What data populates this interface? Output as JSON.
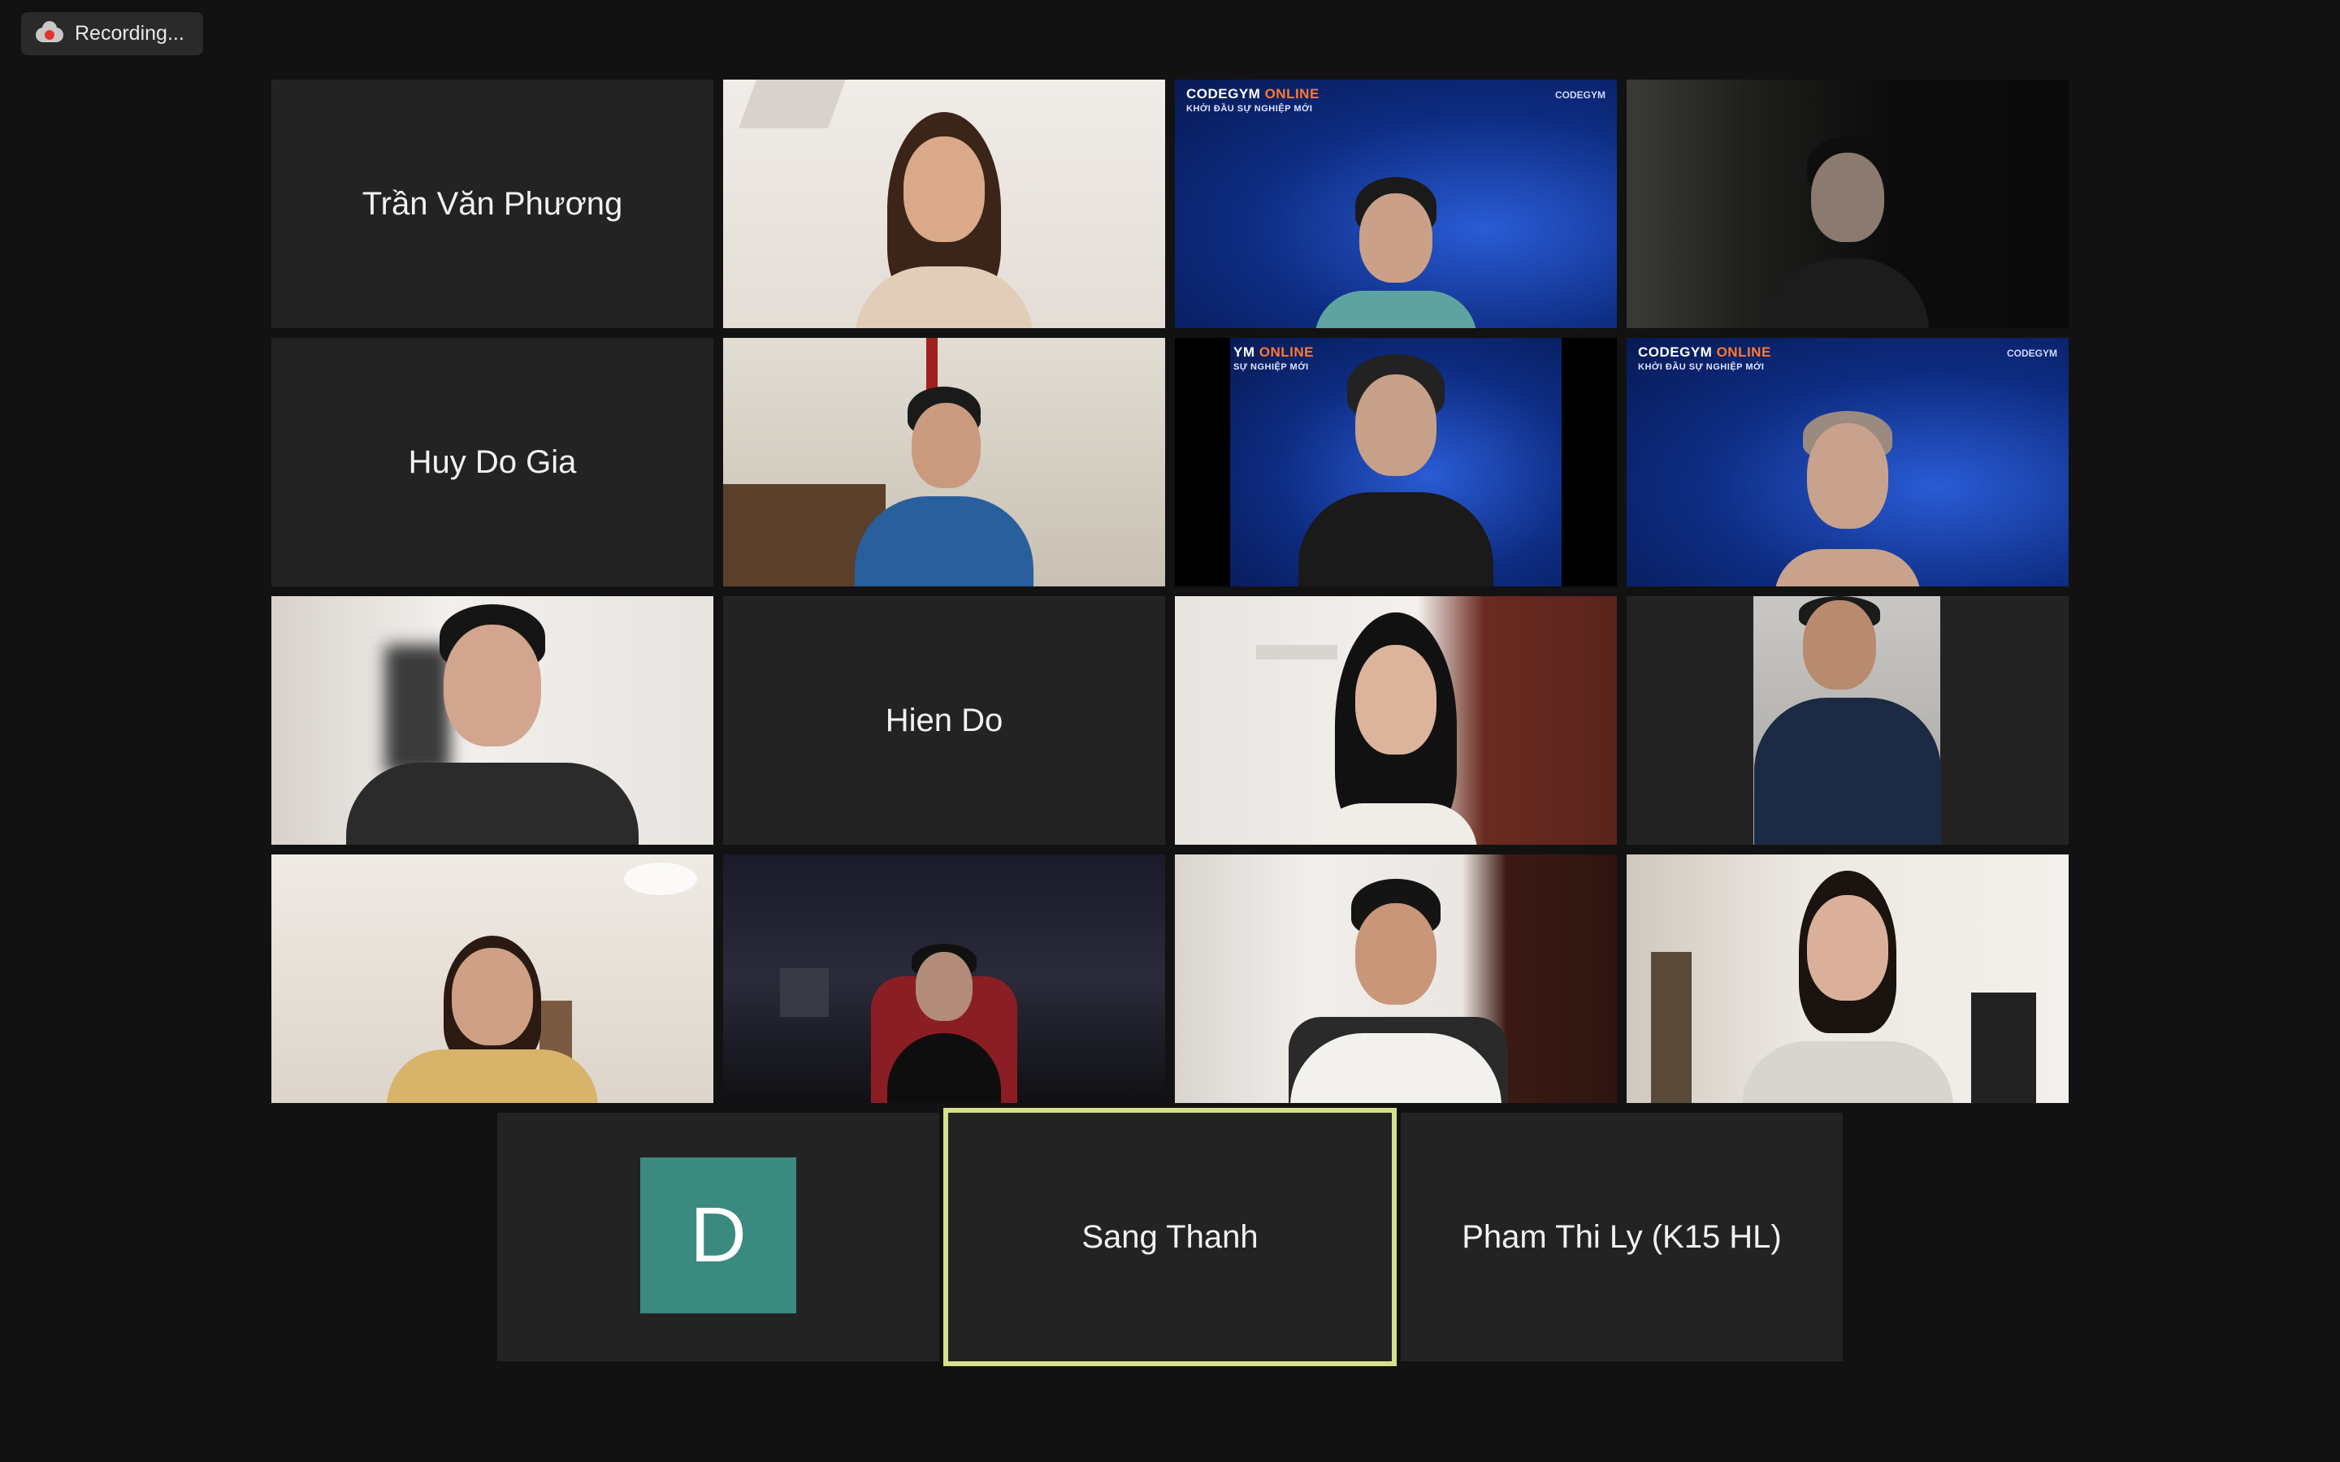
{
  "recording": {
    "label": "Recording..."
  },
  "accent_colors": {
    "active_speaker_border": "#d6e08a",
    "avatar_bg": "#3a8a80",
    "recording_dot": "#e5332a"
  },
  "participants": [
    {
      "name": "Trần Văn Phương",
      "kind": "name-only"
    },
    {
      "kind": "video"
    },
    {
      "kind": "video",
      "background": "codegym"
    },
    {
      "kind": "video"
    },
    {
      "name": "Huy Do Gia",
      "kind": "name-only"
    },
    {
      "kind": "video"
    },
    {
      "kind": "video",
      "background": "codegym"
    },
    {
      "kind": "video",
      "background": "codegym"
    },
    {
      "kind": "video"
    },
    {
      "name": "Hien Do",
      "kind": "name-only"
    },
    {
      "kind": "video"
    },
    {
      "kind": "video"
    },
    {
      "kind": "video"
    },
    {
      "kind": "video"
    },
    {
      "kind": "video"
    },
    {
      "kind": "video"
    },
    {
      "kind": "avatar",
      "initial": "D"
    },
    {
      "name": "Sang Thanh",
      "kind": "name-only",
      "active_speaker": true
    },
    {
      "name": "Pham Thi Ly (K15 HL)",
      "kind": "name-only"
    }
  ],
  "codegym": {
    "brand": "CODEGYM",
    "brand_accent": "ONLINE",
    "tagline": "KHỞI ĐẦU SỰ NGHIỆP MỚI",
    "logo": "CODEGYM"
  },
  "codegym_cropped": {
    "brand": "YM",
    "brand_accent": "ONLINE",
    "tagline": "SỰ NGHIỆP MỚI"
  }
}
